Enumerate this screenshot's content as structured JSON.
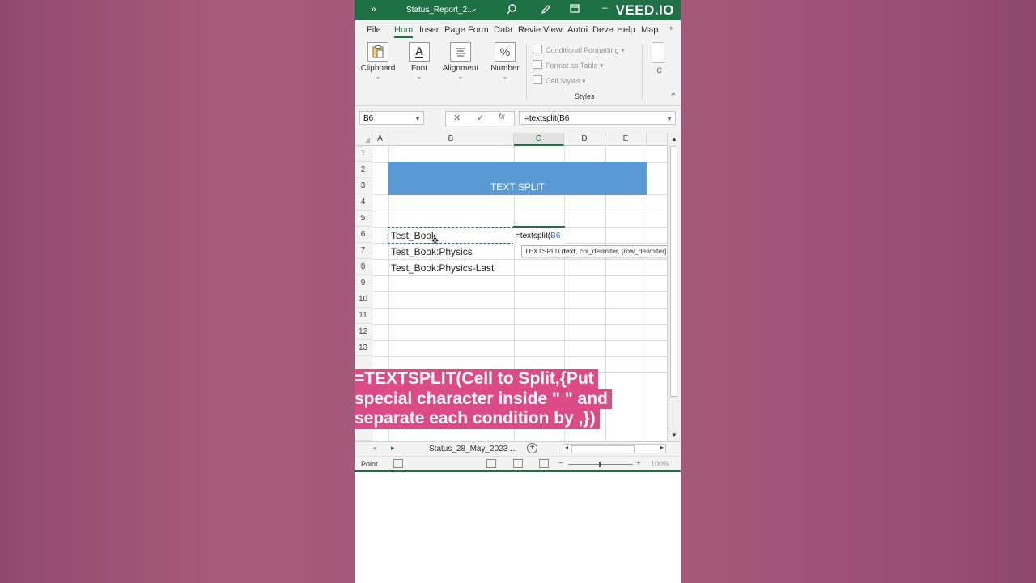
{
  "titlebar": {
    "doc_title": "Status_Report_2...",
    "watermark": "VEED.IO",
    "icons": [
      "more-icon",
      "search-icon",
      "pen-icon",
      "window-icon",
      "minimize-icon"
    ]
  },
  "ribbon_tabs": [
    "File",
    "Hom",
    "Inser",
    "Page",
    "Form",
    "Data",
    "Revie",
    "View",
    "Autoi",
    "Deve",
    "Help",
    "Map"
  ],
  "ribbon_scroll": "›",
  "ribbon_groups": {
    "clipboard": "Clipboard",
    "font": "Font",
    "alignment": "Alignment",
    "number": "Number",
    "number_symbol": "%",
    "font_symbol": "A",
    "styles_items": [
      "Conditional Formatting ▾",
      "Format as Table ▾",
      "Cell Styles ▾"
    ],
    "styles_label": "Styles",
    "cells_partial": "C"
  },
  "formula_bar": {
    "name_box": "B6",
    "cancel": "✕",
    "enter": "✓",
    "fx": "fx",
    "formula": "=textsplit(B6"
  },
  "columns": [
    "A",
    "B",
    "C",
    "D",
    "E"
  ],
  "rows": [
    "1",
    "2",
    "3",
    "4",
    "5",
    "6",
    "7",
    "8",
    "9",
    "10",
    "11",
    "12",
    "13"
  ],
  "cells": {
    "title": "TEXT SPLIT",
    "b6": "Test_Book",
    "b7": "Test_Book:Physics",
    "b8": "Test_Book:Physics-Last",
    "c6_formula_prefix": "=textsplit(",
    "c6_formula_ref": "B6"
  },
  "tooltip": {
    "func": "TEXTSPLIT(",
    "arg_bold": "text",
    "rest": ", col_delimiter, [row_delimiter]"
  },
  "caption_lines": [
    "=TEXTSPLIT(Cell to Split,{Put",
    "special character inside \" \" and",
    "separate each condition by ,})"
  ],
  "sheet_tabs": {
    "prev": "◂",
    "next": "▸",
    "active_sheet": "Status_28_May_2023 ...",
    "add": "+"
  },
  "statusbar": {
    "mode": "Point",
    "zoom_minus": "−",
    "zoom_plus": "+",
    "zoom_pct": "100%"
  },
  "colors": {
    "excel_green": "#1e7145",
    "title_fill": "#5b9bd5",
    "caption_bg": "#dd4b87"
  }
}
